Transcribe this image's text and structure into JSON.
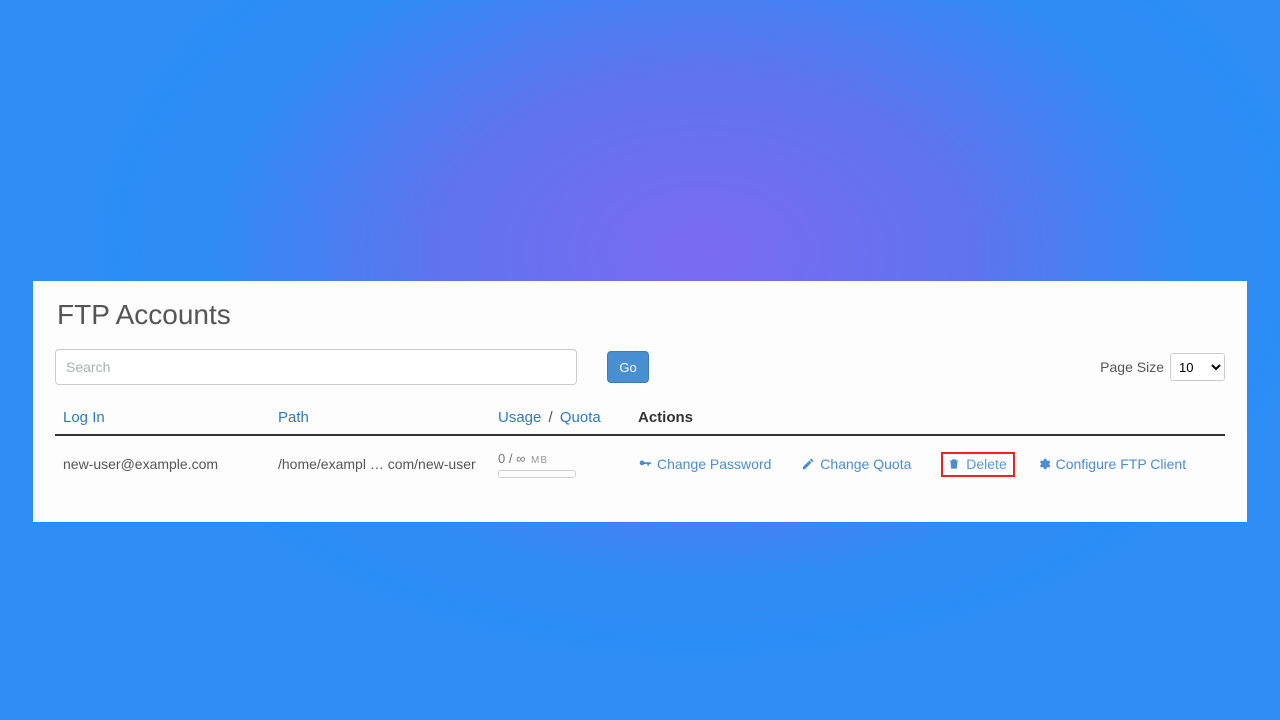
{
  "title": "FTP Accounts",
  "search": {
    "placeholder": "Search",
    "value": ""
  },
  "go_label": "Go",
  "page_size": {
    "label": "Page Size",
    "value": "10"
  },
  "columns": {
    "login": "Log In",
    "path": "Path",
    "usage": "Usage",
    "quota": "Quota",
    "sep": "/",
    "actions": "Actions"
  },
  "row": {
    "login": "new-user@example.com",
    "path_a": "/home/exampl",
    "path_ell": "…",
    "path_b": "com/new-user",
    "usage_value": "0",
    "usage_sep": "/",
    "usage_quota": "∞",
    "usage_unit": "MB"
  },
  "actions": {
    "change_password": "Change Password",
    "change_quota": "Change Quota",
    "delete": "Delete",
    "configure": "Configure FTP Client"
  }
}
